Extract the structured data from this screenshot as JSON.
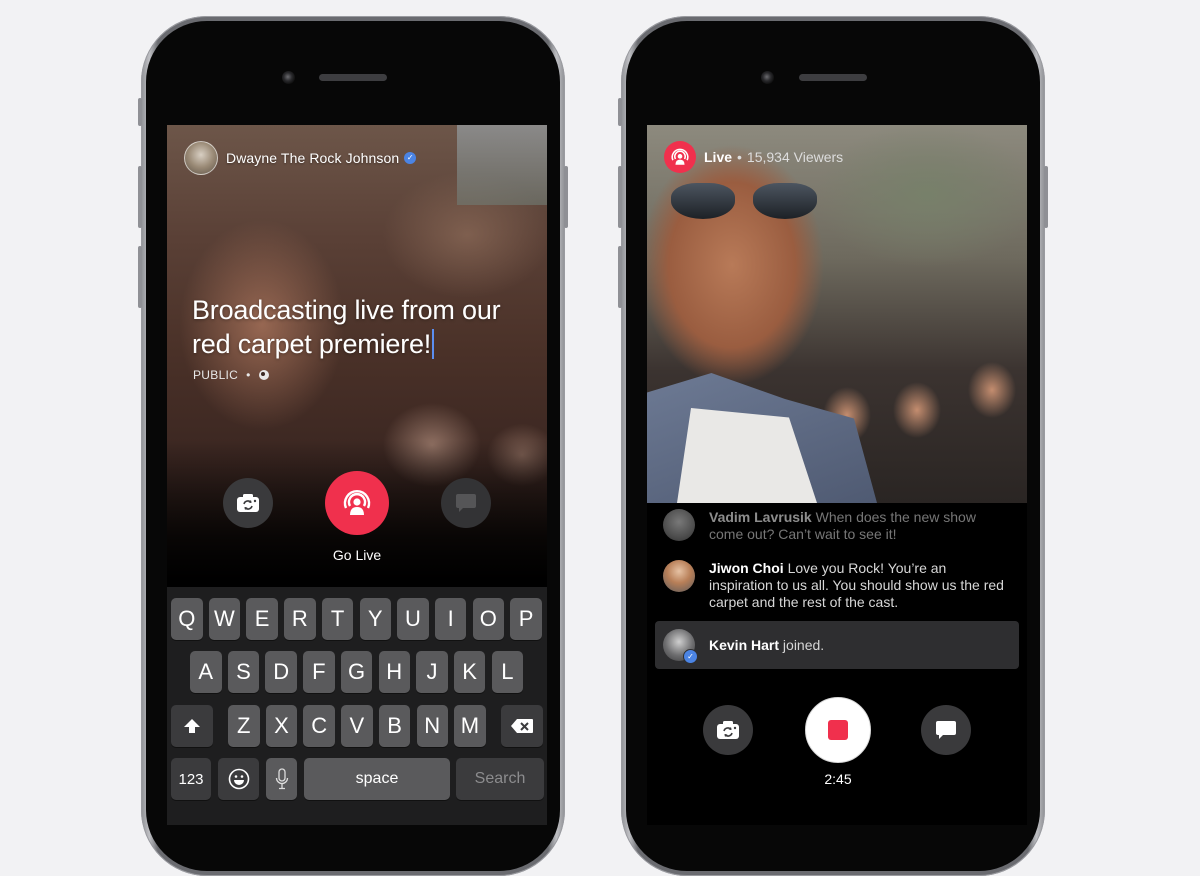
{
  "left_phone": {
    "header": {
      "user_name": "Dwayne The Rock Johnson",
      "verified": true
    },
    "status_text_line1": "Broadcasting live from our",
    "status_text_line2": "red carpet premiere!",
    "privacy": {
      "label": "PUBLIC",
      "separator": "•",
      "icon": "globe-icon"
    },
    "controls": {
      "flip_camera_icon": "flip-camera-icon",
      "go_live_label": "Go Live",
      "go_live_icon": "live-broadcast-icon",
      "comment_icon": "comment-icon"
    },
    "keyboard": {
      "row1": [
        "Q",
        "W",
        "E",
        "R",
        "T",
        "Y",
        "U",
        "I",
        "O",
        "P"
      ],
      "row2": [
        "A",
        "S",
        "D",
        "F",
        "G",
        "H",
        "J",
        "K",
        "L"
      ],
      "row3": [
        "Z",
        "X",
        "C",
        "V",
        "B",
        "N",
        "M"
      ],
      "shift_icon": "shift-icon",
      "delete_icon": "delete-icon",
      "numbers_label": "123",
      "emoji_icon": "emoji-icon",
      "mic_icon": "microphone-icon",
      "space_label": "space",
      "search_label": "Search"
    }
  },
  "right_phone": {
    "header": {
      "live_label": "Live",
      "separator": "•",
      "viewers": "15,934 Viewers"
    },
    "comments": [
      {
        "name": "Vadim Lavrusik",
        "text": "When does the new show come out? Can’t wait to see it!"
      },
      {
        "name": "Jiwon Choi",
        "text": "Love you Rock! You’re an inspiration to us all. You should show us the red carpet and the rest of the cast."
      }
    ],
    "joined": {
      "name": "Kevin Hart",
      "text": "joined.",
      "verified": true
    },
    "controls": {
      "flip_camera_icon": "flip-camera-icon",
      "stop_icon": "stop-icon",
      "comment_icon": "comment-icon",
      "timer": "2:45"
    }
  },
  "colors": {
    "accent_red": "#f0304d",
    "verified_blue": "#4b84e4",
    "background": "#f2f2f4"
  }
}
